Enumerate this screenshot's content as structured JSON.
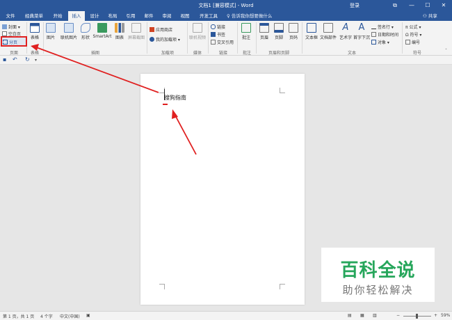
{
  "titlebar": {
    "title": "文档1 [兼容模式] - Word",
    "login": "登录",
    "buttons": {
      "ribbon_opts": "⧉",
      "minimize": "—",
      "maximize": "☐",
      "close": "✕"
    }
  },
  "tabs": [
    "文件",
    "经典菜单",
    "开始",
    "插入",
    "设计",
    "布局",
    "引用",
    "邮件",
    "审阅",
    "视图",
    "开发工具"
  ],
  "active_tab": "插入",
  "tell_me": "告诉我你想要做什么",
  "share": "共享",
  "ribbon": {
    "pages_group": {
      "cover": "封面",
      "blank": "空白页",
      "page_break": "分页",
      "label": "页面"
    },
    "table": {
      "btn": "表格",
      "label": "表格"
    },
    "illustrations": {
      "picture": "图片",
      "online_picture": "联机图片",
      "shapes": "形状",
      "smartart": "SmartArt",
      "chart": "图表",
      "screenshot": "屏幕截图",
      "label": "插图"
    },
    "addins": {
      "store": "应用商店",
      "my_addins": "我的加载项",
      "label": "加载项"
    },
    "media": {
      "online_video": "联机视频",
      "label": "媒体"
    },
    "links": {
      "link": "链接",
      "bookmark": "书签",
      "cross_ref": "交叉引用",
      "label": "链接"
    },
    "comments": {
      "comment": "批注",
      "label": "批注"
    },
    "header_footer": {
      "header": "页眉",
      "footer": "页脚",
      "page_number": "页码",
      "label": "页眉和页脚"
    },
    "text": {
      "textbox": "文本框",
      "doc_parts": "文档部件",
      "wordart": "艺术字",
      "dropcap": "首字下沉",
      "signature": "签名行",
      "datetime": "日期和时间",
      "object": "对象",
      "label": "文本"
    },
    "symbols": {
      "equation": "公式",
      "symbol": "符号",
      "number": "编号",
      "label": "符号"
    }
  },
  "document": {
    "text": "搜狗指南"
  },
  "watermark": {
    "line1": "百科全说",
    "line2": "助你轻松解决"
  },
  "status": {
    "pages": "第 1 页，共 1 页",
    "words": "4 个字",
    "language": "中文(中国)",
    "zoom": "59%"
  },
  "colors": {
    "brand": "#2b579a",
    "highlight": "#e02020",
    "watermark": "#26a65b"
  }
}
